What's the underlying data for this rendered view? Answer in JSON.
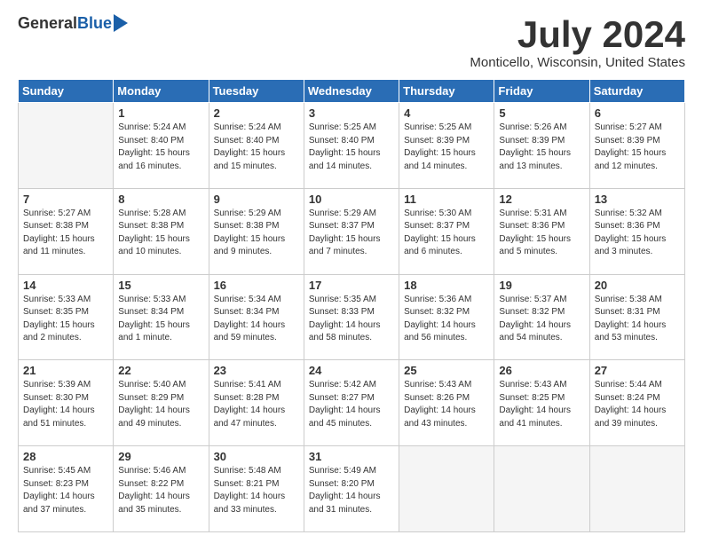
{
  "header": {
    "logo_general": "General",
    "logo_blue": "Blue",
    "month_title": "July 2024",
    "location": "Monticello, Wisconsin, United States"
  },
  "calendar": {
    "headers": [
      "Sunday",
      "Monday",
      "Tuesday",
      "Wednesday",
      "Thursday",
      "Friday",
      "Saturday"
    ],
    "rows": [
      [
        {
          "day": "",
          "info": ""
        },
        {
          "day": "1",
          "info": "Sunrise: 5:24 AM\nSunset: 8:40 PM\nDaylight: 15 hours\nand 16 minutes."
        },
        {
          "day": "2",
          "info": "Sunrise: 5:24 AM\nSunset: 8:40 PM\nDaylight: 15 hours\nand 15 minutes."
        },
        {
          "day": "3",
          "info": "Sunrise: 5:25 AM\nSunset: 8:40 PM\nDaylight: 15 hours\nand 14 minutes."
        },
        {
          "day": "4",
          "info": "Sunrise: 5:25 AM\nSunset: 8:39 PM\nDaylight: 15 hours\nand 14 minutes."
        },
        {
          "day": "5",
          "info": "Sunrise: 5:26 AM\nSunset: 8:39 PM\nDaylight: 15 hours\nand 13 minutes."
        },
        {
          "day": "6",
          "info": "Sunrise: 5:27 AM\nSunset: 8:39 PM\nDaylight: 15 hours\nand 12 minutes."
        }
      ],
      [
        {
          "day": "7",
          "info": "Sunrise: 5:27 AM\nSunset: 8:38 PM\nDaylight: 15 hours\nand 11 minutes."
        },
        {
          "day": "8",
          "info": "Sunrise: 5:28 AM\nSunset: 8:38 PM\nDaylight: 15 hours\nand 10 minutes."
        },
        {
          "day": "9",
          "info": "Sunrise: 5:29 AM\nSunset: 8:38 PM\nDaylight: 15 hours\nand 9 minutes."
        },
        {
          "day": "10",
          "info": "Sunrise: 5:29 AM\nSunset: 8:37 PM\nDaylight: 15 hours\nand 7 minutes."
        },
        {
          "day": "11",
          "info": "Sunrise: 5:30 AM\nSunset: 8:37 PM\nDaylight: 15 hours\nand 6 minutes."
        },
        {
          "day": "12",
          "info": "Sunrise: 5:31 AM\nSunset: 8:36 PM\nDaylight: 15 hours\nand 5 minutes."
        },
        {
          "day": "13",
          "info": "Sunrise: 5:32 AM\nSunset: 8:36 PM\nDaylight: 15 hours\nand 3 minutes."
        }
      ],
      [
        {
          "day": "14",
          "info": "Sunrise: 5:33 AM\nSunset: 8:35 PM\nDaylight: 15 hours\nand 2 minutes."
        },
        {
          "day": "15",
          "info": "Sunrise: 5:33 AM\nSunset: 8:34 PM\nDaylight: 15 hours\nand 1 minute."
        },
        {
          "day": "16",
          "info": "Sunrise: 5:34 AM\nSunset: 8:34 PM\nDaylight: 14 hours\nand 59 minutes."
        },
        {
          "day": "17",
          "info": "Sunrise: 5:35 AM\nSunset: 8:33 PM\nDaylight: 14 hours\nand 58 minutes."
        },
        {
          "day": "18",
          "info": "Sunrise: 5:36 AM\nSunset: 8:32 PM\nDaylight: 14 hours\nand 56 minutes."
        },
        {
          "day": "19",
          "info": "Sunrise: 5:37 AM\nSunset: 8:32 PM\nDaylight: 14 hours\nand 54 minutes."
        },
        {
          "day": "20",
          "info": "Sunrise: 5:38 AM\nSunset: 8:31 PM\nDaylight: 14 hours\nand 53 minutes."
        }
      ],
      [
        {
          "day": "21",
          "info": "Sunrise: 5:39 AM\nSunset: 8:30 PM\nDaylight: 14 hours\nand 51 minutes."
        },
        {
          "day": "22",
          "info": "Sunrise: 5:40 AM\nSunset: 8:29 PM\nDaylight: 14 hours\nand 49 minutes."
        },
        {
          "day": "23",
          "info": "Sunrise: 5:41 AM\nSunset: 8:28 PM\nDaylight: 14 hours\nand 47 minutes."
        },
        {
          "day": "24",
          "info": "Sunrise: 5:42 AM\nSunset: 8:27 PM\nDaylight: 14 hours\nand 45 minutes."
        },
        {
          "day": "25",
          "info": "Sunrise: 5:43 AM\nSunset: 8:26 PM\nDaylight: 14 hours\nand 43 minutes."
        },
        {
          "day": "26",
          "info": "Sunrise: 5:43 AM\nSunset: 8:25 PM\nDaylight: 14 hours\nand 41 minutes."
        },
        {
          "day": "27",
          "info": "Sunrise: 5:44 AM\nSunset: 8:24 PM\nDaylight: 14 hours\nand 39 minutes."
        }
      ],
      [
        {
          "day": "28",
          "info": "Sunrise: 5:45 AM\nSunset: 8:23 PM\nDaylight: 14 hours\nand 37 minutes."
        },
        {
          "day": "29",
          "info": "Sunrise: 5:46 AM\nSunset: 8:22 PM\nDaylight: 14 hours\nand 35 minutes."
        },
        {
          "day": "30",
          "info": "Sunrise: 5:48 AM\nSunset: 8:21 PM\nDaylight: 14 hours\nand 33 minutes."
        },
        {
          "day": "31",
          "info": "Sunrise: 5:49 AM\nSunset: 8:20 PM\nDaylight: 14 hours\nand 31 minutes."
        },
        {
          "day": "",
          "info": ""
        },
        {
          "day": "",
          "info": ""
        },
        {
          "day": "",
          "info": ""
        }
      ]
    ]
  }
}
